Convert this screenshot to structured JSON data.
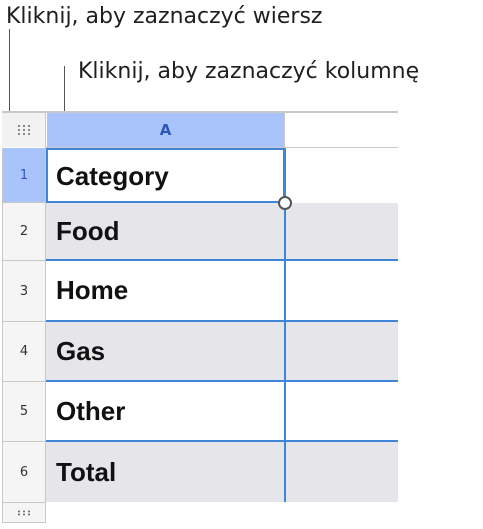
{
  "callouts": {
    "select_row": "Kliknij, aby zaznaczyć wiersz",
    "select_column": "Kliknij, aby zaznaczyć kolumnę"
  },
  "table": {
    "column_header": "A",
    "rows": [
      {
        "number": "1",
        "value": "Category",
        "selected": true
      },
      {
        "number": "2",
        "value": "Food"
      },
      {
        "number": "3",
        "value": "Home"
      },
      {
        "number": "4",
        "value": "Gas"
      },
      {
        "number": "5",
        "value": "Other"
      },
      {
        "number": "6",
        "value": "Total"
      }
    ]
  },
  "colors": {
    "selection_blue": "#3f86d8",
    "header_highlight": "#a8c4fa",
    "alt_row_shade": "#e5e5ea"
  },
  "icons": {
    "table_handle": "grip-dots-icon",
    "row_handle": "grip-dots-icon",
    "cell_resize": "resize-handle-icon"
  }
}
